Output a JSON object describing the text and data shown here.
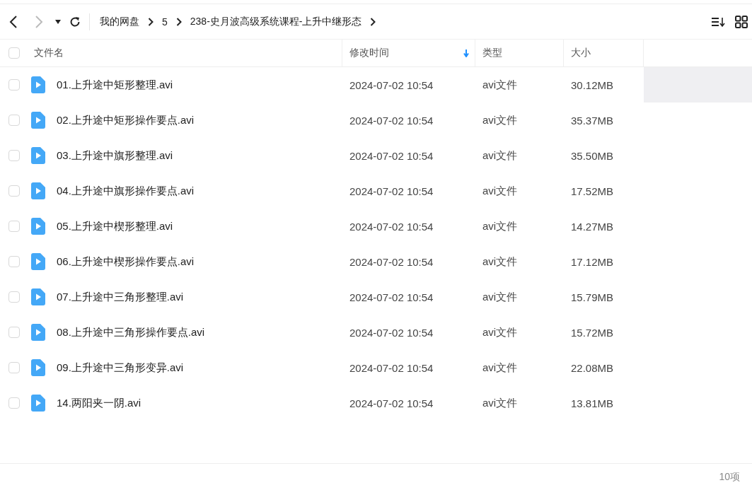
{
  "toolbar": {
    "back_disabled": false,
    "forward_disabled": true,
    "breadcrumbs": [
      "我的网盘",
      "5",
      "238-史月波高级系统课程-上升中继形态"
    ]
  },
  "table": {
    "select_all_checked": false,
    "columns": [
      {
        "label": "文件名",
        "sorted": false
      },
      {
        "label": "修改时间",
        "sorted": true
      },
      {
        "label": "类型",
        "sorted": false
      },
      {
        "label": "大小",
        "sorted": false
      }
    ],
    "rows": [
      {
        "name": "01.上升途中矩形整理.avi",
        "modified": "2024-07-02 10:54",
        "type": "avi文件",
        "size": "30.12MB",
        "hovered": true,
        "checked": false
      },
      {
        "name": "02.上升途中矩形操作要点.avi",
        "modified": "2024-07-02 10:54",
        "type": "avi文件",
        "size": "35.37MB",
        "hovered": false,
        "checked": false
      },
      {
        "name": "03.上升途中旗形整理.avi",
        "modified": "2024-07-02 10:54",
        "type": "avi文件",
        "size": "35.50MB",
        "hovered": false,
        "checked": false
      },
      {
        "name": "04.上升途中旗形操作要点.avi",
        "modified": "2024-07-02 10:54",
        "type": "avi文件",
        "size": "17.52MB",
        "hovered": false,
        "checked": false
      },
      {
        "name": "05.上升途中楔形整理.avi",
        "modified": "2024-07-02 10:54",
        "type": "avi文件",
        "size": "14.27MB",
        "hovered": false,
        "checked": false
      },
      {
        "name": "06.上升途中楔形操作要点.avi",
        "modified": "2024-07-02 10:54",
        "type": "avi文件",
        "size": "17.12MB",
        "hovered": false,
        "checked": false
      },
      {
        "name": "07.上升途中三角形整理.avi",
        "modified": "2024-07-02 10:54",
        "type": "avi文件",
        "size": "15.79MB",
        "hovered": false,
        "checked": false
      },
      {
        "name": "08.上升途中三角形操作要点.avi",
        "modified": "2024-07-02 10:54",
        "type": "avi文件",
        "size": "15.72MB",
        "hovered": false,
        "checked": false
      },
      {
        "name": "09.上升途中三角形变异.avi",
        "modified": "2024-07-02 10:54",
        "type": "avi文件",
        "size": "22.08MB",
        "hovered": false,
        "checked": false
      },
      {
        "name": "14.两阳夹一阴.avi",
        "modified": "2024-07-02 10:54",
        "type": "avi文件",
        "size": "13.81MB",
        "hovered": false,
        "checked": false
      }
    ]
  },
  "status_bar": {
    "count": "10项"
  }
}
